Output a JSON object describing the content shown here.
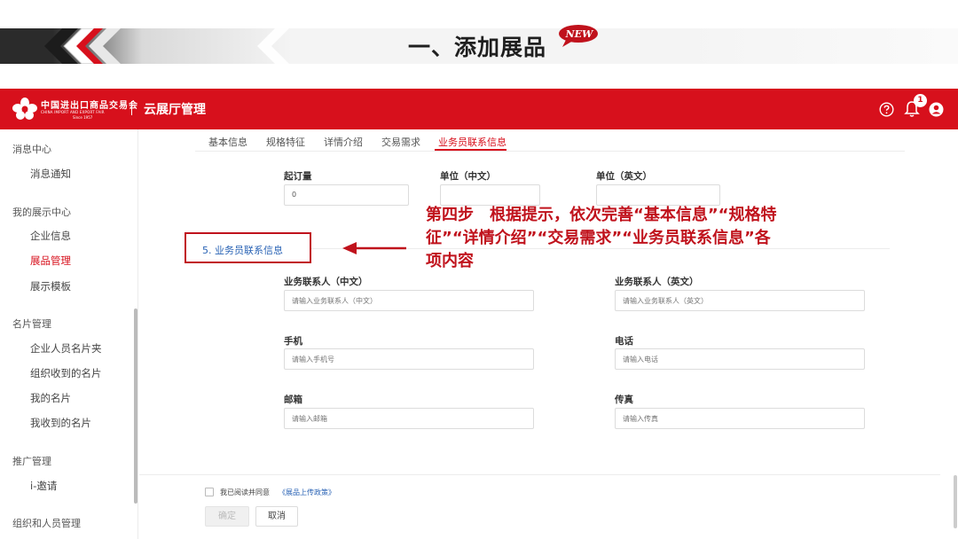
{
  "slide": {
    "title": "一、添加展品",
    "badge": "NEW"
  },
  "app": {
    "logo_text": "中国进出口商品交易会",
    "logo_sub": "CHINA IMPORT AND EXPORT FAIR",
    "logo_since": "Since 1957",
    "name": "云展厅管理",
    "notification_count": "1",
    "brand_color": "#d7101c"
  },
  "sidebar": {
    "groups": [
      {
        "label": "消息中心",
        "items": [
          "消息通知"
        ]
      },
      {
        "label": "我的展示中心",
        "items": [
          "企业信息",
          "展品管理",
          "展示模板"
        ]
      },
      {
        "label": "名片管理",
        "items": [
          "企业人员名片夹",
          "组织收到的名片",
          "我的名片",
          "我收到的名片"
        ]
      },
      {
        "label": "推广管理",
        "items": [
          "i-邀请"
        ]
      },
      {
        "label": "组织和人员管理",
        "items": []
      }
    ],
    "active_item": "展品管理"
  },
  "tabs": [
    "基本信息",
    "规格特征",
    "详情介绍",
    "交易需求",
    "业务员联系信息"
  ],
  "active_tab": "业务员联系信息",
  "order_fields": [
    {
      "label": "起订量",
      "value": "0"
    },
    {
      "label": "单位（中文）",
      "value": ""
    },
    {
      "label": "单位（英文）",
      "value": ""
    }
  ],
  "section_title": "5. 业务员联系信息",
  "contact_fields": [
    {
      "label": "业务联系人（中文）",
      "placeholder": "请输入业务联系人（中文）"
    },
    {
      "label": "业务联系人（英文）",
      "placeholder": "请输入业务联系人（英文）"
    },
    {
      "label": "手机",
      "placeholder": "请输入手机号"
    },
    {
      "label": "电话",
      "placeholder": "请输入电话"
    },
    {
      "label": "邮箱",
      "placeholder": "请输入邮箱"
    },
    {
      "label": "传真",
      "placeholder": "请输入传真"
    }
  ],
  "annotation": "第四步　根据提示，依次完善“基本信息”“规格特征”“详情介绍”“交易需求”“业务员联系信息”各项内容",
  "footer": {
    "agree_text": "我已阅读并同意",
    "policy_link": "《展品上传政策》",
    "confirm_label": "确定",
    "cancel_label": "取消"
  }
}
